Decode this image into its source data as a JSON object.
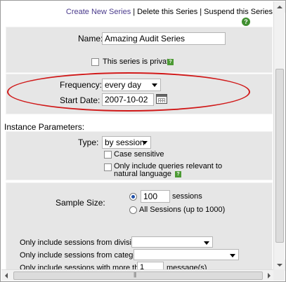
{
  "header": {
    "create_link": "Create New Series",
    "separator": "|",
    "delete_link": "Delete this Series",
    "suspend_link": "Suspend this Series",
    "help_glyph": "?"
  },
  "series": {
    "name_label": "Name:",
    "name_value": "Amazing Audit Series",
    "private_label": "This series is private",
    "private_checked": false,
    "frequency_label": "Frequency:",
    "frequency_value": "every day",
    "start_date_label": "Start Date:",
    "start_date_value": "2007-10-02"
  },
  "instance": {
    "title": "Instance Parameters:",
    "type_label": "Type:",
    "type_value": "by session",
    "case_sensitive_label": "Case sensitive",
    "natural_language_label_1": "Only include queries relevant to",
    "natural_language_label_2": "natural language",
    "sample_size_label": "Sample Size:",
    "sessions_value": "100",
    "sessions_unit": "sessions",
    "all_sessions_label": "All Sessions (up to 1000)",
    "division_label": "Only include sessions from division:",
    "division_value": "",
    "category_label": "Only include sessions from category:",
    "category_value": "",
    "more_than_label": "Only include sessions with more than:",
    "more_than_value": "1",
    "more_than_unit": "message(s)"
  },
  "icons": {
    "help": "question-mark-icon",
    "calendar": "calendar-icon",
    "dropdown": "chevron-down-icon"
  },
  "colors": {
    "link": "#4a3a8c",
    "panel": "#e6e6e6",
    "highlight": "#d01818",
    "help": "#4c9a34"
  },
  "scrollbars": {
    "h_grip": "|||"
  }
}
